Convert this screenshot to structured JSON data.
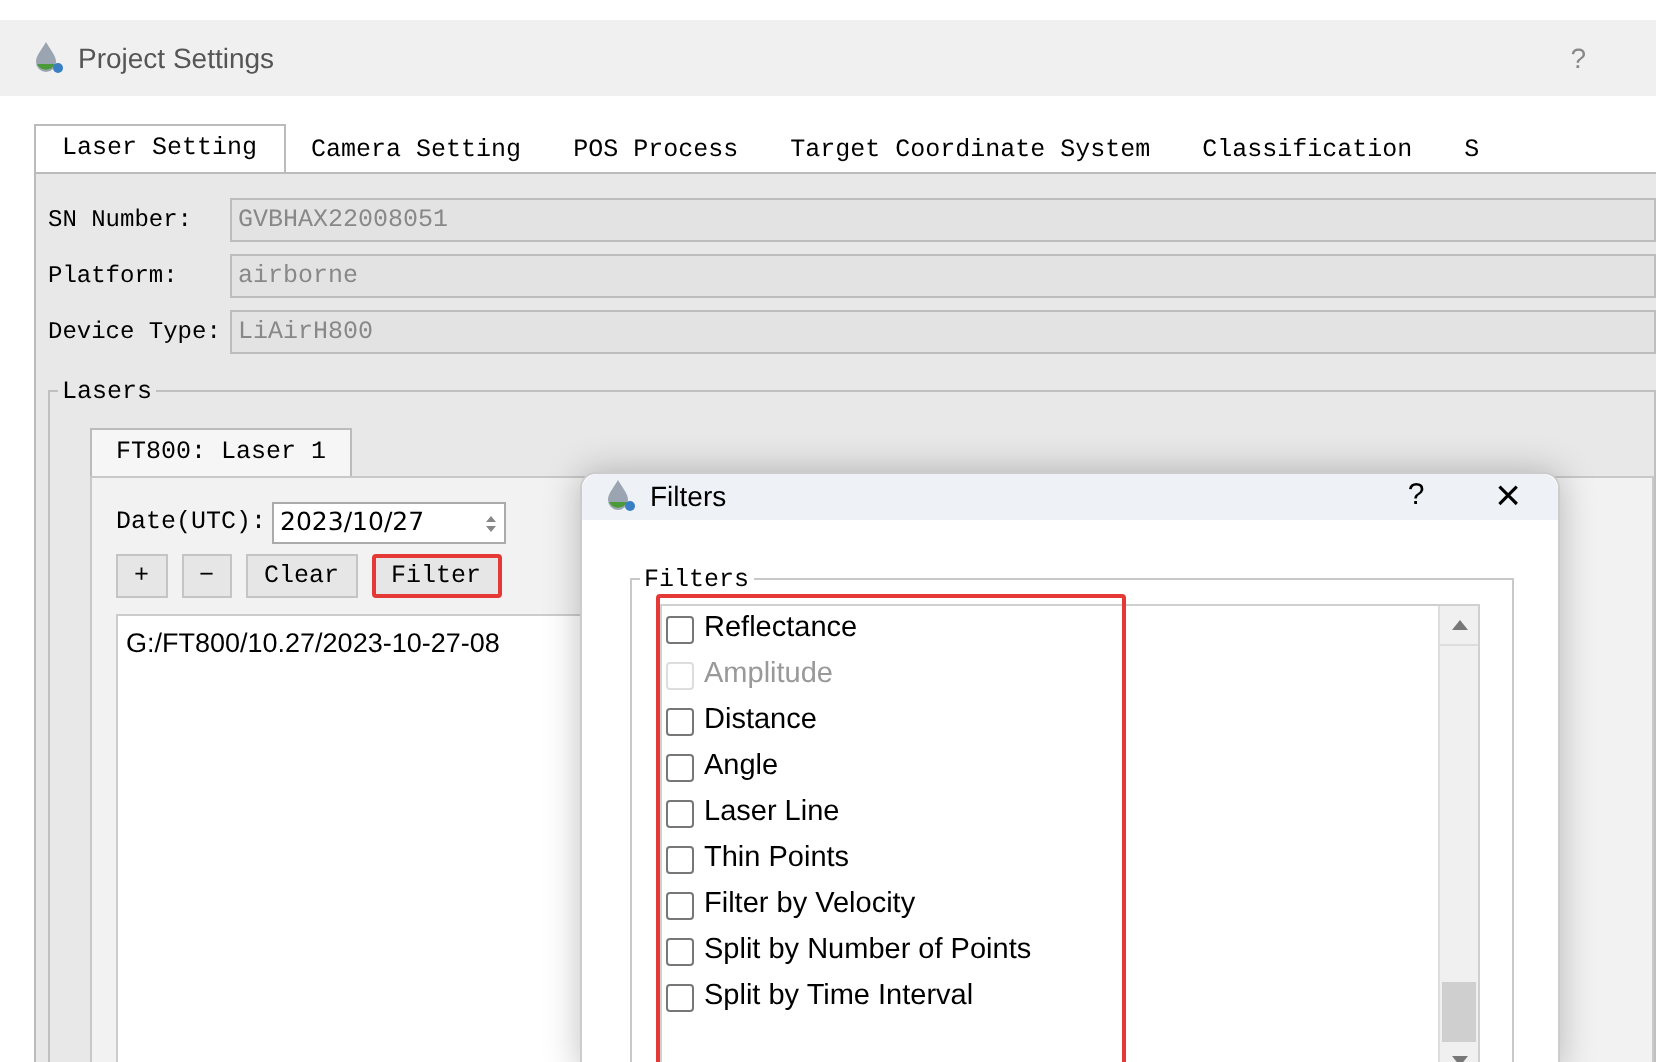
{
  "window": {
    "title": "Project Settings",
    "help": "?"
  },
  "tabs": [
    {
      "label": "Laser Setting",
      "selected": true
    },
    {
      "label": "Camera Setting",
      "selected": false
    },
    {
      "label": "POS Process",
      "selected": false
    },
    {
      "label": "Target Coordinate System",
      "selected": false
    },
    {
      "label": "Classification",
      "selected": false
    },
    {
      "label": "S",
      "selected": false
    }
  ],
  "fields": [
    {
      "label": "SN Number:",
      "value": "GVBHAX22008051",
      "disabled": true
    },
    {
      "label": "Platform:",
      "value": "airborne",
      "disabled": true
    },
    {
      "label": "Device Type:",
      "value": "LiAirH800",
      "disabled": true
    }
  ],
  "lasers": {
    "title": "Lasers",
    "tabs": [
      {
        "label": "FT800: Laser 1",
        "selected": true
      }
    ],
    "date_label": "Date(UTC):",
    "date_value": "2023/10/27",
    "buttons": [
      {
        "label": "+",
        "highlighted": false
      },
      {
        "label": "−",
        "highlighted": false
      },
      {
        "label": "Clear",
        "highlighted": false
      },
      {
        "label": "Filter",
        "highlighted": true
      }
    ],
    "files": [
      "G:/FT800/10.27/2023-10-27-08"
    ]
  },
  "dialog": {
    "title": "Filters",
    "help": "?",
    "close": "×",
    "group_title": "Filters",
    "highlighted": true,
    "items": [
      {
        "label": "Reflectance",
        "checked": false,
        "disabled": false
      },
      {
        "label": "Amplitude",
        "checked": false,
        "disabled": true
      },
      {
        "label": "Distance",
        "checked": false,
        "disabled": false
      },
      {
        "label": "Angle",
        "checked": false,
        "disabled": false
      },
      {
        "label": "Laser Line",
        "checked": false,
        "disabled": false
      },
      {
        "label": "Thin Points",
        "checked": false,
        "disabled": false
      },
      {
        "label": "Filter by Velocity",
        "checked": false,
        "disabled": false
      },
      {
        "label": "Split by Number of Points",
        "checked": false,
        "disabled": false
      },
      {
        "label": "Split by Time Interval",
        "checked": false,
        "disabled": false
      }
    ]
  }
}
